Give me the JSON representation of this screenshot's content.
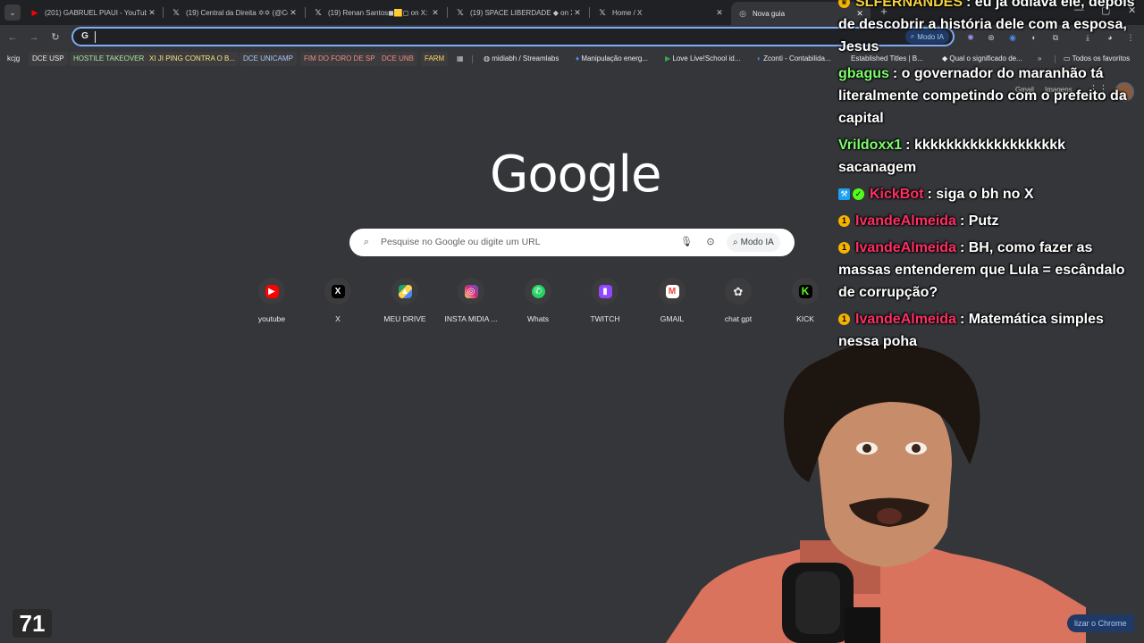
{
  "tabs": [
    {
      "title": "(201) GABRUEL PIAUI - YouTube",
      "icon": "youtube-icon"
    },
    {
      "title": "(19) Central da Direita ✡✡ (@Ce",
      "icon": "x-icon"
    },
    {
      "title": "(19) Renan Santos◼🟨◻ on X:",
      "icon": "x-icon"
    },
    {
      "title": "(19) SPACE LIBERDADE ◆ on X:",
      "icon": "x-icon"
    },
    {
      "title": "Home / X",
      "icon": "x-icon"
    },
    {
      "title": "Nova guia",
      "icon": "chrome-icon"
    }
  ],
  "omnibox": {
    "value": "",
    "modo_ia": "Modo IA"
  },
  "bookmarks": [
    "kcjg",
    "DCE USP",
    "HOSTILE TAKEOVER",
    "XI JI PING CONTRA O B...",
    "DCE UNICAMP",
    "FIM DO FORO DE SP",
    "DCE UNB",
    "FARM",
    "midiabh / Streamlabs",
    "Manipulação energ...",
    "Love Live!School id...",
    "Zconti - Contabilida...",
    "Established Titles | B...",
    "Qual o significado de...",
    "Todos os favoritos"
  ],
  "ntp": {
    "logo": "Google",
    "search_placeholder": "Pesquise no Google ou digite um URL",
    "modo_ia": "Modo IA",
    "links": [
      "Gmail",
      "Imagens"
    ],
    "customize": "Personalizar o Chrome",
    "customize_visible": "lizar o Chrome"
  },
  "shortcuts": [
    {
      "label": "youtube",
      "icon": "youtube-icon",
      "color": "#ff0000"
    },
    {
      "label": "X",
      "icon": "x-icon",
      "color": "#000000"
    },
    {
      "label": "MEU DRIVE",
      "icon": "drive-icon",
      "color": "#1fa463"
    },
    {
      "label": "INSTA MIDIA ...",
      "icon": "instagram-icon",
      "color": "#d62976"
    },
    {
      "label": "Whats",
      "icon": "whatsapp-icon",
      "color": "#25d366"
    },
    {
      "label": "TWITCH",
      "icon": "twitch-icon",
      "color": "#9146ff"
    },
    {
      "label": "GMAIL",
      "icon": "gmail-icon",
      "color": "#ea4335"
    },
    {
      "label": "chat gpt",
      "icon": "chatgpt-icon",
      "color": "#5f6368"
    },
    {
      "label": "KICK",
      "icon": "kick-icon",
      "color": "#53fc18"
    }
  ],
  "chat": [
    {
      "user": "SLFERNANDES",
      "color": "#f4d03f",
      "text": "eu já odiava ele, depois de descobrir a história dele com a esposa, Jesus"
    },
    {
      "user": "gbagus",
      "color": "#7cfc6a",
      "text": "o governador do maranhão tá literalmente competindo com o prefeito da capital"
    },
    {
      "user": "Vrildoxx1",
      "color": "#7cfc6a",
      "text": "kkkkkkkkkkkkkkkkkkk sacanagem"
    },
    {
      "user": "KickBot",
      "color": "#ff2e63",
      "text": "siga o bh no X"
    },
    {
      "user": "IvandeAlmeida",
      "color": "#ff2e63",
      "text": "Putz"
    },
    {
      "user": "IvandeAlmeida",
      "color": "#ff2e63",
      "text": "BH, como fazer as massas entenderem que Lula = escândalo de corrupção?"
    },
    {
      "user": "IvandeAlmeida",
      "color": "#ff2e63",
      "text": "Matemática simples nessa poha"
    }
  ],
  "counter": "71"
}
